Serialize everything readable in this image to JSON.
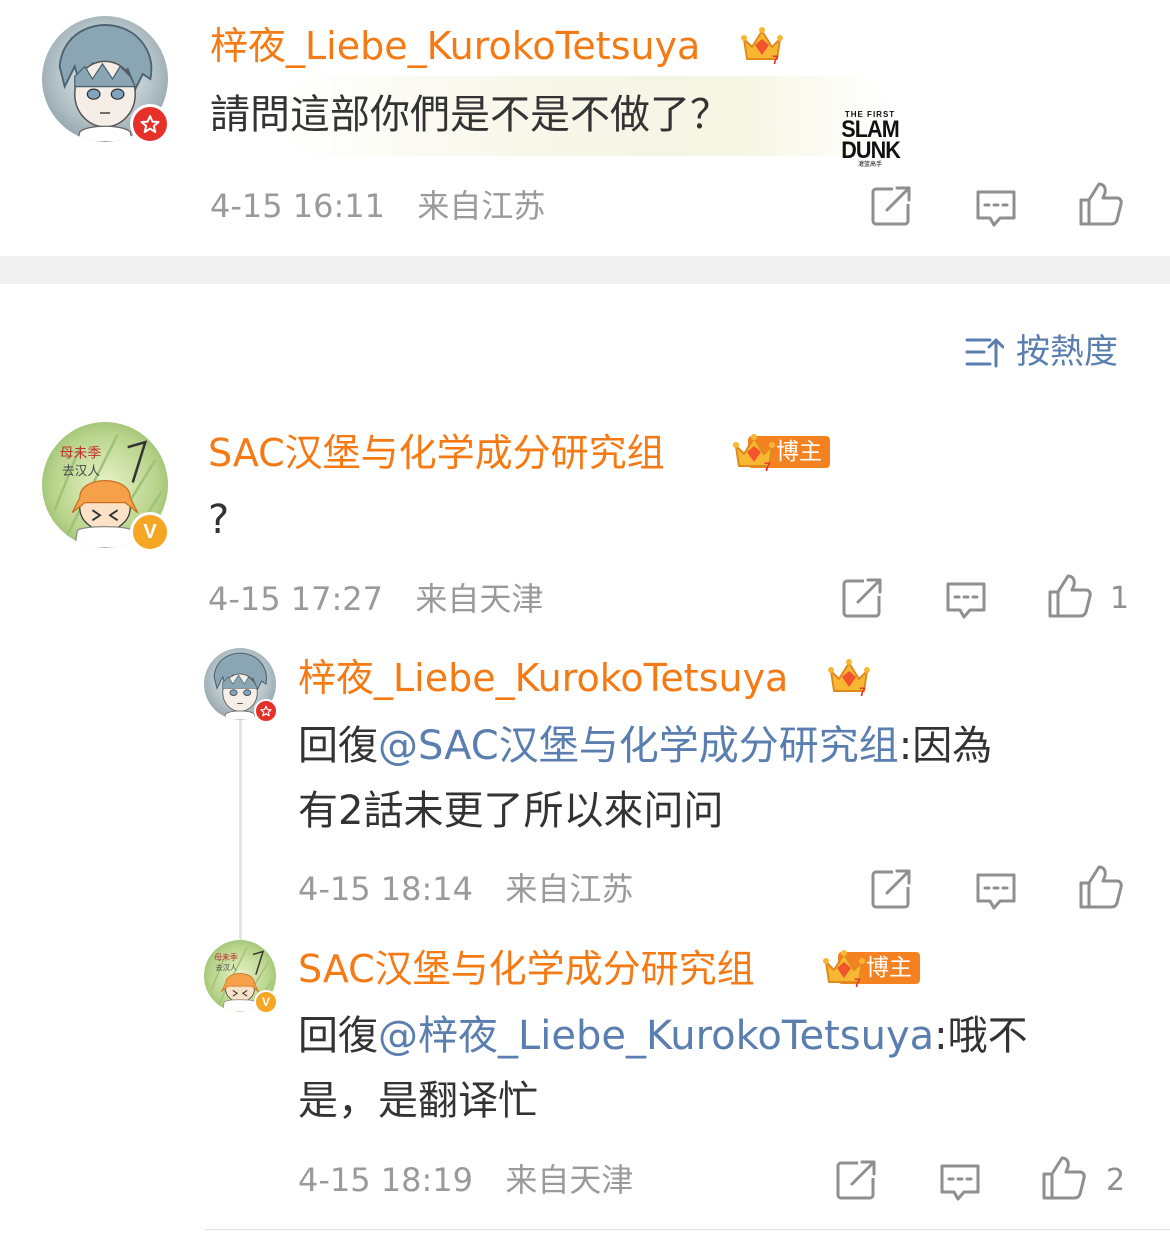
{
  "top_comment": {
    "username": "梓夜_Liebe_KurokoTetsuya",
    "text": "請問這部你們是不是不做了？",
    "sticker_text": [
      "THE FIRST",
      "SLAM",
      "DUNK",
      "灌篮高手"
    ],
    "timestamp": "4-15 16:11",
    "location": "来自江苏"
  },
  "sort": {
    "label": "按熱度"
  },
  "main_comment": {
    "username": "SAC汉堡与化学成分研究组",
    "badge": "博主",
    "text": "?",
    "timestamp": "4-15 17:27",
    "location": "来自天津",
    "like_count": "1"
  },
  "replies": [
    {
      "username": "梓夜_Liebe_KurokoTetsuya",
      "reply_prefix": "回復",
      "mention": "@SAC汉堡与化学成分研究组",
      "text_line1_rest": ":因為",
      "text_line2": "有2話未更了所以來问问",
      "timestamp": "4-15 18:14",
      "location": "来自江苏"
    },
    {
      "username": "SAC汉堡与化学成分研究组",
      "badge": "博主",
      "reply_prefix": "回復",
      "mention": "@梓夜_Liebe_KurokoTetsuya",
      "text_line1_rest": ":哦不",
      "text_line2": "是，是翻译忙",
      "timestamp": "4-15 18:19",
      "location": "来自天津",
      "like_count": "2"
    }
  ],
  "icons": [
    "share-icon",
    "comment-icon",
    "like-icon",
    "sort-icon",
    "crown-icon"
  ],
  "colors": {
    "username": "#f57a14",
    "mention": "#5b7eb0",
    "meta": "#9a9a9a",
    "badge_red": "#e6312b",
    "badge_gold": "#f5a623"
  }
}
